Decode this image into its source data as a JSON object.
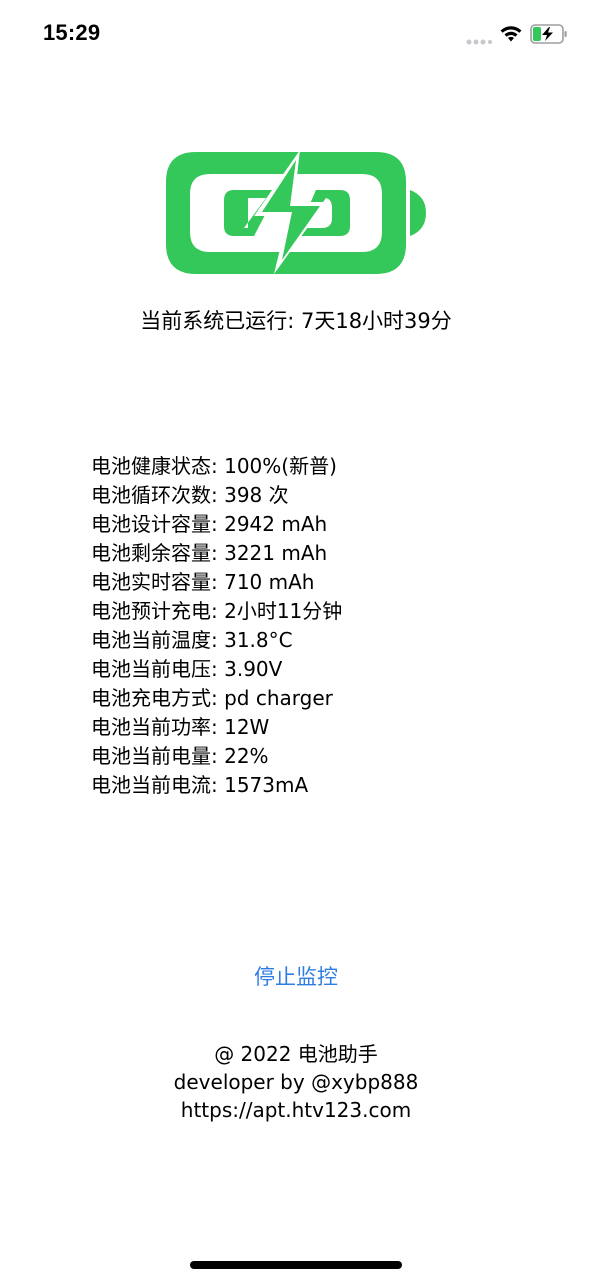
{
  "status_bar": {
    "time": "15:29",
    "icons": [
      "signal-dots-icon",
      "wifi-icon",
      "battery-charging-icon"
    ]
  },
  "hero": {
    "icon": "battery-charging-icon",
    "color": "#34c759"
  },
  "uptime": {
    "label": "当前系统已运行: 7天18小时39分"
  },
  "battery_info": [
    {
      "label": "电池健康状态: ",
      "value": "100%(新普)"
    },
    {
      "label": "电池循环次数: ",
      "value": "398 次"
    },
    {
      "label": "电池设计容量: ",
      "value": "2942 mAh"
    },
    {
      "label": "电池剩余容量: ",
      "value": "3221 mAh"
    },
    {
      "label": "电池实时容量: ",
      "value": "710 mAh"
    },
    {
      "label": "电池预计充电: ",
      "value": "2小时11分钟"
    },
    {
      "label": "电池当前温度: ",
      "value": "31.8°C"
    },
    {
      "label": "电池当前电压: ",
      "value": "3.90V"
    },
    {
      "label": "电池充电方式: ",
      "value": "pd charger"
    },
    {
      "label": "电池当前功率: ",
      "value": "12W"
    },
    {
      "label": "电池当前电量: ",
      "value": "22%"
    },
    {
      "label": "电池当前电流: ",
      "value": "1573mA"
    }
  ],
  "actions": {
    "stop_label": "停止监控",
    "accent": "#2f7de1"
  },
  "footer": {
    "line1": "@ 2022 电池助手",
    "line2": "developer by @xybp888",
    "line3": "https://apt.htv123.com"
  }
}
